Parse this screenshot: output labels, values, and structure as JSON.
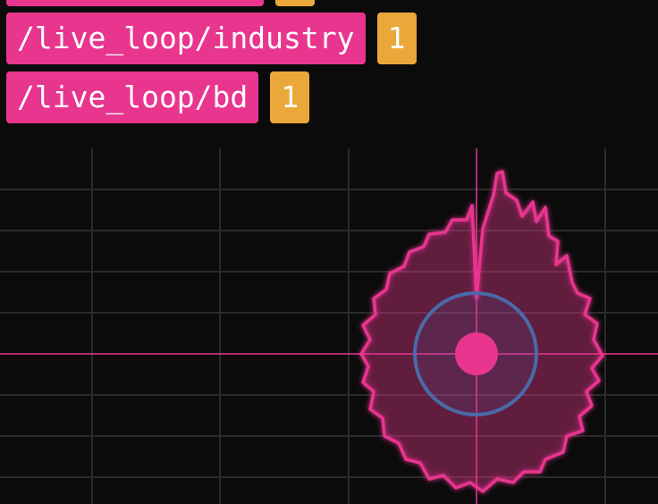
{
  "cue_log": {
    "rows": [
      {
        "name": "",
        "count": ""
      },
      {
        "name": "/live_loop/industry",
        "count": "1"
      },
      {
        "name": "/live_loop/bd",
        "count": "1"
      }
    ]
  },
  "scope": {
    "grid_color": "#2a2a2a",
    "crosshair_color": "#e8368f",
    "waveform_color": "#e8368f",
    "ring_color": "#4a6aa8",
    "center_dot_color": "#e8368f"
  }
}
